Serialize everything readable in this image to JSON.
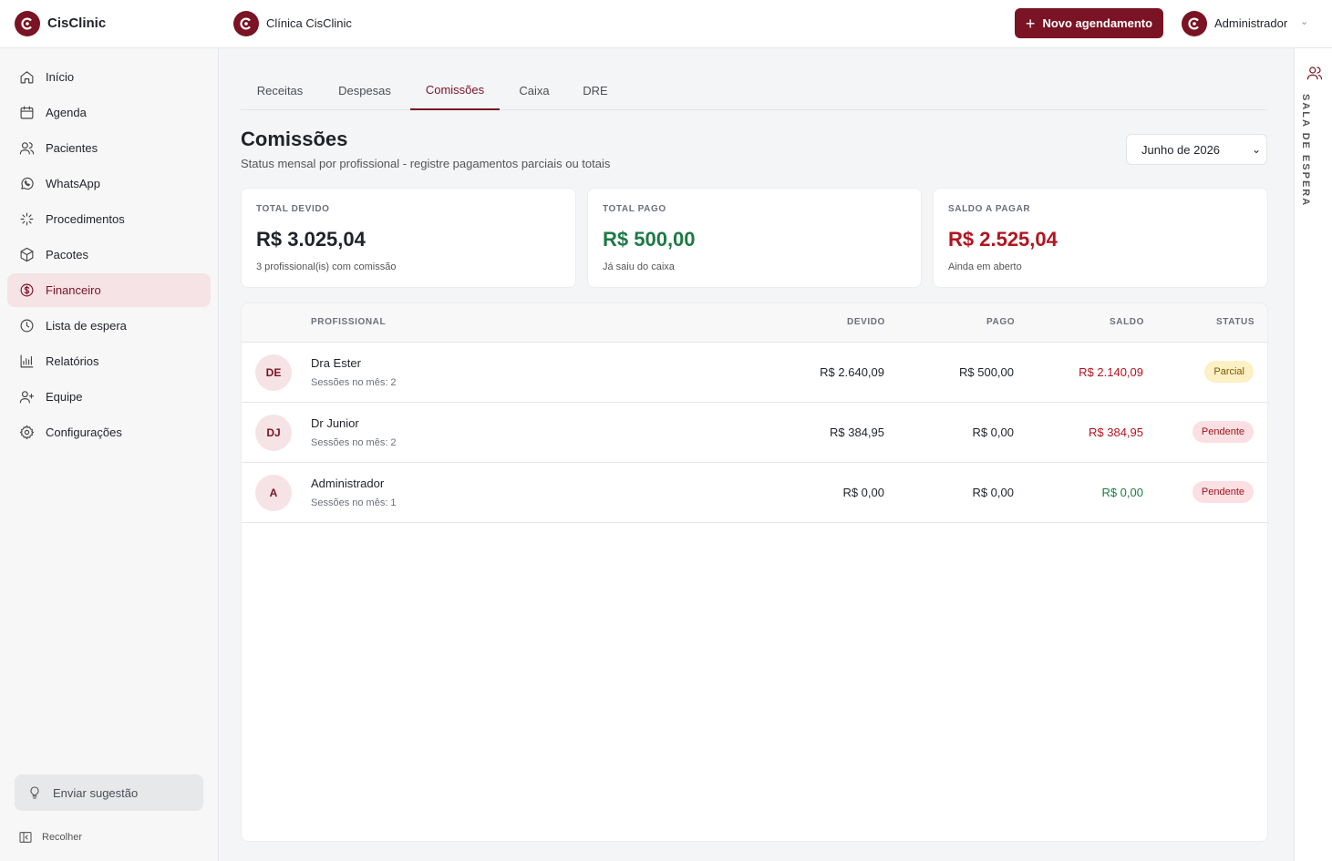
{
  "brand": {
    "name": "CisClinic"
  },
  "clinic": {
    "name": "Clínica CisClinic"
  },
  "header": {
    "new_button": "Novo agendamento",
    "user": "Administrador"
  },
  "sidebar": {
    "items": [
      {
        "label": "Início",
        "icon": "home-icon"
      },
      {
        "label": "Agenda",
        "icon": "calendar-icon"
      },
      {
        "label": "Pacientes",
        "icon": "users-icon"
      },
      {
        "label": "WhatsApp",
        "icon": "whatsapp-icon"
      },
      {
        "label": "Procedimentos",
        "icon": "sparkle-icon"
      },
      {
        "label": "Pacotes",
        "icon": "package-icon"
      },
      {
        "label": "Financeiro",
        "icon": "dollar-icon",
        "active": true
      },
      {
        "label": "Lista de espera",
        "icon": "clock-icon"
      },
      {
        "label": "Relatórios",
        "icon": "bar-chart-icon"
      },
      {
        "label": "Equipe",
        "icon": "user-plus-icon"
      },
      {
        "label": "Configurações",
        "icon": "gear-icon"
      }
    ],
    "suggest": "Enviar sugestão",
    "collapse": "Recolher"
  },
  "rail": {
    "label": "SALA DE ESPERA"
  },
  "tabs": [
    "Receitas",
    "Despesas",
    "Comissões",
    "Caixa",
    "DRE"
  ],
  "page": {
    "title": "Comissões",
    "subtitle": "Status mensal por profissional - registre pagamentos parciais ou totais",
    "month": "Junho de 2026"
  },
  "cards": [
    {
      "label": "TOTAL DEVIDO",
      "value": "R$ 3.025,04",
      "note": "3 profissional(is) com comissão",
      "color": "#1f2328"
    },
    {
      "label": "TOTAL PAGO",
      "value": "R$ 500,00",
      "note": "Já saiu do caixa",
      "color": "#1e7a45"
    },
    {
      "label": "SALDO A PAGAR",
      "value": "R$ 2.525,04",
      "note": "Ainda em aberto",
      "color": "#b3141f"
    }
  ],
  "table": {
    "headers": {
      "profissional": "PROFISSIONAL",
      "devido": "DEVIDO",
      "pago": "PAGO",
      "saldo": "SALDO",
      "status": "STATUS"
    },
    "rows": [
      {
        "initials": "DE",
        "name": "Dra Ester",
        "sessions": "Sessões no mês: 2",
        "devido": "R$ 2.640,09",
        "pago": "R$ 500,00",
        "saldo": "R$ 2.140,09",
        "saldo_color": "#b3141f",
        "status": "Parcial",
        "status_bg": "#fdf0c4",
        "status_fg": "#7a5a00"
      },
      {
        "initials": "DJ",
        "name": "Dr Junior",
        "sessions": "Sessões no mês: 2",
        "devido": "R$ 384,95",
        "pago": "R$ 0,00",
        "saldo": "R$ 384,95",
        "saldo_color": "#b3141f",
        "status": "Pendente",
        "status_bg": "#fbe0e3",
        "status_fg": "#a3121d"
      },
      {
        "initials": "A",
        "name": "Administrador",
        "sessions": "Sessões no mês: 1",
        "devido": "R$ 0,00",
        "pago": "R$ 0,00",
        "saldo": "R$ 0,00",
        "saldo_color": "#1e7a45",
        "status": "Pendente",
        "status_bg": "#fbe0e3",
        "status_fg": "#a3121d"
      }
    ]
  },
  "colors": {
    "brand": "#7a1323",
    "positive": "#1e7a45",
    "negative": "#b3141f"
  }
}
